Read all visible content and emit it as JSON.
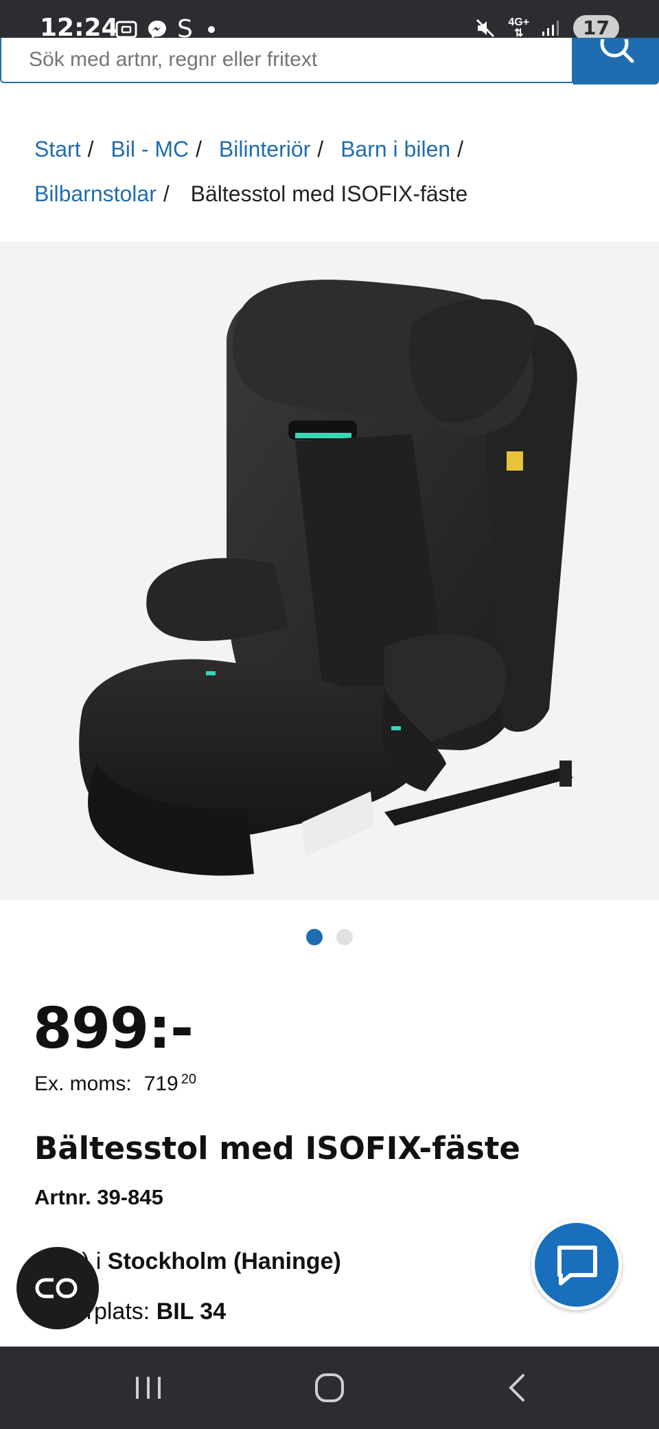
{
  "status_bar": {
    "time": "12:24",
    "app_icons": [
      "screenshot-icon",
      "messenger-icon",
      "S"
    ],
    "network_label": "4G+",
    "battery": "17"
  },
  "search": {
    "placeholder": "Sök med artnr, regnr eller fritext"
  },
  "breadcrumb": {
    "items": [
      "Start",
      "Bil - MC",
      "Bilinteriör",
      "Barn i bilen",
      "Bilbarnstolar"
    ],
    "current": "Bältesstol med ISOFIX-fäste",
    "separator": "/"
  },
  "carousel": {
    "total": 2,
    "active_index": 0
  },
  "product": {
    "price": "899:-",
    "ex_moms_label": "Ex. moms:",
    "ex_moms_value": "719",
    "ex_moms_decimals": "20",
    "title": "Bältesstol med ISOFIX-fäste",
    "artnr": "Artnr. 39-845",
    "stock_prefix": "(20+) i",
    "stock_store": "Stockholm (Haninge)",
    "location_label": "Lagerplats:",
    "location_value": "BIL 34"
  },
  "floating": {
    "left_button_icon": "co-logo-icon",
    "right_button_icon": "chat-icon"
  },
  "colors": {
    "accent": "#1f6db0",
    "status_bar_bg": "#2b2d30",
    "image_bg": "#f3f3f3"
  }
}
